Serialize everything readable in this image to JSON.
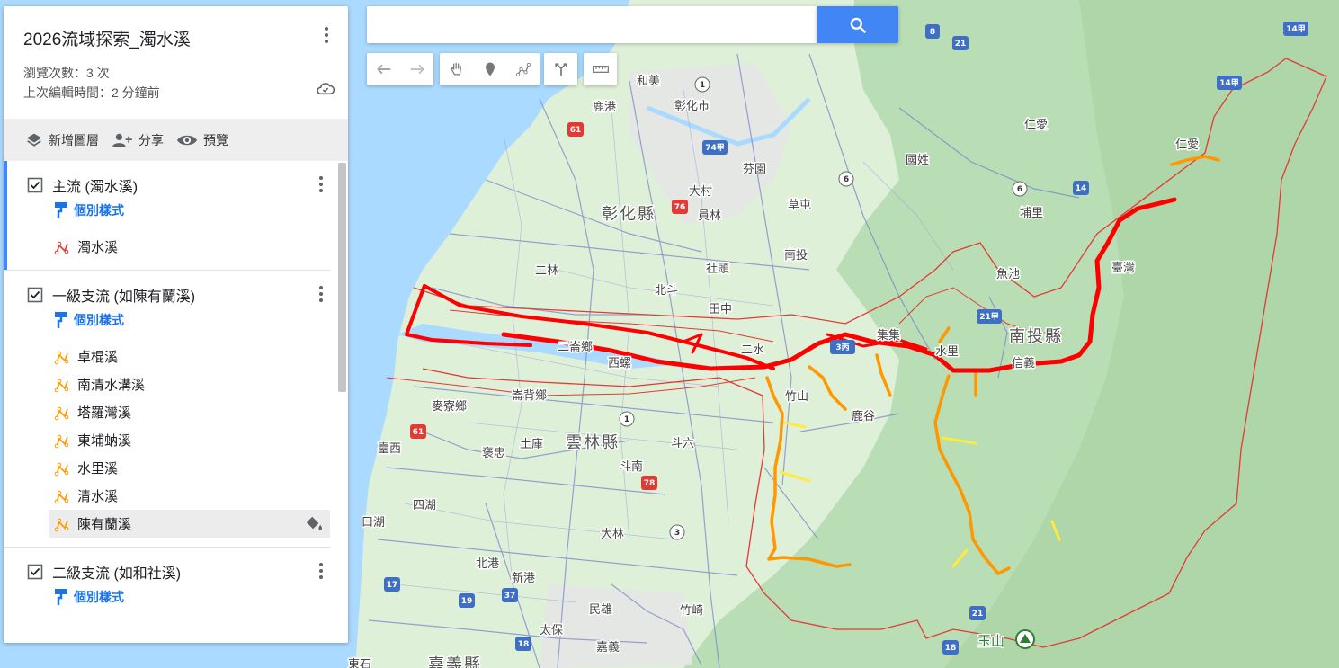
{
  "map": {
    "labels": {
      "hemei": "和美",
      "lukang": "鹿港",
      "changhua_city": "彰化市",
      "fenyuan": "芬園",
      "guoxing": "國姓",
      "renai1": "仁愛",
      "renai2": "仁愛",
      "damu": "大村",
      "yuanlin": "員林",
      "caotun": "草屯",
      "puli": "埔里",
      "changhua_county": "彰化縣",
      "nantou": "南投",
      "ershui_sheto": "社頭",
      "yuchi": "魚池",
      "taiwan": "臺灣",
      "erlin": "二林",
      "beidou": "北斗",
      "tianzhong": "田中",
      "nantou_county": "南投縣",
      "jiji": "集集",
      "ershui": "二水",
      "erlun": "二崙鄉",
      "xiluo": "西螺",
      "zhushan": "竹山",
      "lugu": "鹿谷",
      "shuili": "水里",
      "xinyi": "信義",
      "mailiao": "麥寮鄉",
      "lunbei": "崙背鄉",
      "taixi": "臺西",
      "baozhong": "褒忠",
      "tuku": "土庫",
      "yunlin_county": "雲林縣",
      "douliu": "斗六",
      "dounan": "斗南",
      "sihu": "四湖",
      "kouhu": "口湖",
      "dalin": "大林",
      "beigang": "北港",
      "xingang": "新港",
      "minxiong": "民雄",
      "zhuqi": "竹崎",
      "taibao": "太保",
      "jiayi": "嘉義",
      "dongshi": "東石",
      "chiayi_county": "嘉義縣",
      "yushan": "玉山"
    },
    "shields": {
      "r8": "8",
      "r21a": "21",
      "r1": "1",
      "r61a": "61",
      "r74": "74甲",
      "r76": "76",
      "r6a": "6",
      "r6b": "6",
      "r14a": "14甲",
      "r14b": "14甲",
      "r14": "14",
      "r21b": "21甲",
      "r3c": "3丙",
      "r61b": "61",
      "r1b": "1",
      "r78": "78",
      "r3": "3",
      "r17": "17",
      "r19": "19",
      "r37": "37",
      "r18a": "18",
      "r21c": "21",
      "r18b": "18"
    },
    "colors": {
      "water": "#aadaff",
      "land": "#d6eed3",
      "forest": "#b9ddb4",
      "main_stream": "#ff0000",
      "tributary1": "#ff9800",
      "tributary2": "#ffeb3b",
      "basin": "#e53935",
      "road": "#7a86c9"
    }
  },
  "search": {
    "placeholder": "",
    "value": ""
  },
  "toolbar": {
    "undo_icon": "undo-icon",
    "redo_icon": "redo-icon",
    "pan_icon": "hand-icon",
    "marker_icon": "marker-icon",
    "line_icon": "draw-line-icon",
    "directions_icon": "directions-icon",
    "measure_icon": "ruler-icon"
  },
  "panel": {
    "title": "2026流域探索_濁水溪",
    "views": "瀏覽次數：3 次",
    "last_edit": "上次編輯時間：2 分鐘前",
    "actions": {
      "add_layer": "新增圖層",
      "share": "分享",
      "preview": "預覽"
    },
    "layers": [
      {
        "name": "主流 (濁水溪)",
        "style": "個別樣式",
        "features": [
          "濁水溪"
        ]
      },
      {
        "name": "一級支流 (如陳有蘭溪)",
        "style": "個別樣式",
        "features": [
          "卓棍溪",
          "南清水溝溪",
          "塔羅灣溪",
          "東埔蚋溪",
          "水里溪",
          "清水溪",
          "陳有蘭溪"
        ]
      },
      {
        "name": "二級支流 (如和社溪)",
        "style": "個別樣式"
      }
    ]
  }
}
